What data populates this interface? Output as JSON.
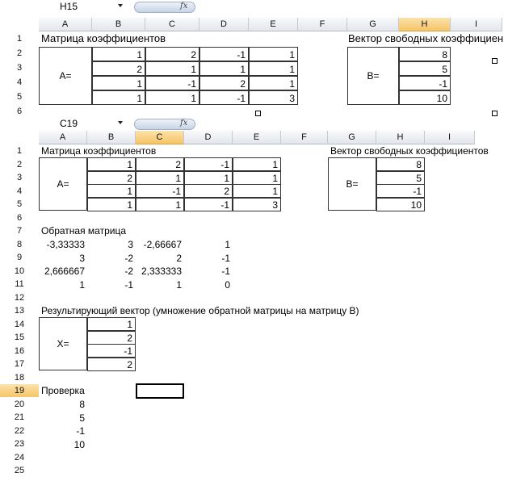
{
  "top": {
    "name_box": "H15",
    "fx_label": "fx",
    "columns": [
      "A",
      "B",
      "C",
      "D",
      "E",
      "F",
      "G",
      "H",
      "I"
    ],
    "rows": [
      "1",
      "2",
      "3",
      "4",
      "5",
      "6"
    ],
    "header_left": "Матрица коэффициентов",
    "header_right": "Вектор свободных коэффициен",
    "a_label": "A=",
    "b_label": "B=",
    "matrix": [
      [
        "1",
        "2",
        "-1",
        "1"
      ],
      [
        "2",
        "1",
        "1",
        "1"
      ],
      [
        "1",
        "-1",
        "2",
        "1"
      ],
      [
        "1",
        "1",
        "-1",
        "3"
      ]
    ],
    "vector": [
      "8",
      "5",
      "-1",
      "10"
    ]
  },
  "bottom": {
    "name_box": "C19",
    "fx_label": "fx",
    "columns": [
      "A",
      "B",
      "C",
      "D",
      "E",
      "F",
      "G",
      "H",
      "I"
    ],
    "rows": [
      "1",
      "2",
      "3",
      "4",
      "5",
      "6",
      "7",
      "8",
      "9",
      "10",
      "11",
      "12",
      "13",
      "14",
      "15",
      "16",
      "17",
      "18",
      "19",
      "20",
      "21",
      "22",
      "23",
      "24",
      "25"
    ],
    "header_left": "Матрица коэффициентов",
    "header_right": "Вектор свободных коэффициентов",
    "a_label": "A=",
    "b_label": "B=",
    "matrix": [
      [
        "1",
        "2",
        "-1",
        "1"
      ],
      [
        "2",
        "1",
        "1",
        "1"
      ],
      [
        "1",
        "-1",
        "2",
        "1"
      ],
      [
        "1",
        "1",
        "-1",
        "3"
      ]
    ],
    "vector": [
      "8",
      "5",
      "-1",
      "10"
    ],
    "inverse_title": "Обратная матрица",
    "inverse": [
      [
        "-3,33333",
        "3",
        "-2,66667",
        "1"
      ],
      [
        "3",
        "-2",
        "2",
        "-1"
      ],
      [
        "2,666667",
        "-2",
        "2,333333",
        "-1"
      ],
      [
        "1",
        "-1",
        "1",
        "0"
      ]
    ],
    "result_title": "Результирующий вектор (умножение обратной матрицы на матрицу В)",
    "x_label": "X=",
    "result": [
      "1",
      "2",
      "-1",
      "2"
    ],
    "check_title": "Проверка",
    "check": [
      "8",
      "5",
      "-1",
      "10"
    ]
  }
}
